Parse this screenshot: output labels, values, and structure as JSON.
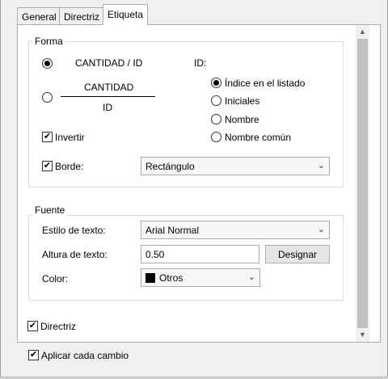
{
  "tabs": [
    {
      "label": "General",
      "active": false
    },
    {
      "label": "Directriz",
      "active": false
    },
    {
      "label": "Etiqueta",
      "active": true
    }
  ],
  "forma": {
    "legend": "Forma",
    "option_single": "CANTIDAD / ID",
    "option_stacked_top": "CANTIDAD",
    "option_stacked_bottom": "ID",
    "id_label": "ID:",
    "id_options": [
      "Índice en el listado",
      "Iniciales",
      "Nombre",
      "Nombre común"
    ],
    "id_selected": "Índice en el listado",
    "invertir_label": "Invertir",
    "invertir_checked": true,
    "borde_label": "Borde:",
    "borde_checked": true,
    "borde_value": "Rectángulo"
  },
  "fuente": {
    "legend": "Fuente",
    "estilo_label": "Estilo de texto:",
    "estilo_value": "Arial Normal",
    "altura_label": "Altura de texto:",
    "altura_value": "0.50",
    "designar_label": "Designar",
    "color_label": "Color:",
    "color_value": "Otros",
    "color_swatch": "#000000"
  },
  "directriz": {
    "label": "Directriz",
    "checked": true
  },
  "aplicar": {
    "label": "Aplicar cada cambio",
    "checked": true
  },
  "icons": {
    "check": "✔",
    "dropdown": "⌄",
    "scroll_up": "▲",
    "scroll_down": "▼"
  }
}
